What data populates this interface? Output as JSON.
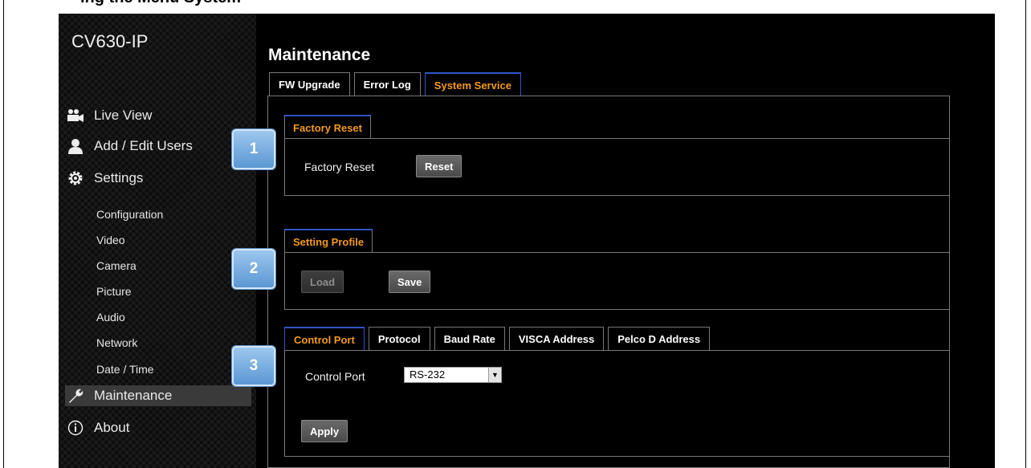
{
  "doc_heading": "ing the Menu System",
  "brand": "CV630-IP",
  "sidebar": {
    "main": [
      {
        "label": "Live View",
        "icon": "video-camera-icon"
      },
      {
        "label": "Add / Edit Users",
        "icon": "user-icon"
      },
      {
        "label": "Settings",
        "icon": "gear-icon"
      },
      {
        "label": "Maintenance",
        "icon": "wrench-icon"
      },
      {
        "label": "About",
        "icon": "info-icon"
      }
    ],
    "sub": [
      "Configuration",
      "Video",
      "Camera",
      "Picture",
      "Audio",
      "Network",
      "Date / Time"
    ]
  },
  "page_title": "Maintenance",
  "tabs": [
    "FW Upgrade",
    "Error Log",
    "System Service"
  ],
  "active_tab": "System Service",
  "factory_reset": {
    "section_title": "Factory Reset",
    "label": "Factory Reset",
    "button": "Reset"
  },
  "setting_profile": {
    "section_title": "Setting Profile",
    "load_button": "Load",
    "save_button": "Save"
  },
  "control": {
    "tabs": [
      "Control Port",
      "Protocol",
      "Baud Rate",
      "VISCA Address",
      "Pelco D Address"
    ],
    "active_tab": "Control Port",
    "label": "Control Port",
    "select_value": "RS-232",
    "apply_button": "Apply"
  },
  "badges": [
    "1",
    "2",
    "3"
  ],
  "colors": {
    "accent": "#f39a1e",
    "tab_border": "#2f55c4",
    "badge": "#5b97d4"
  }
}
